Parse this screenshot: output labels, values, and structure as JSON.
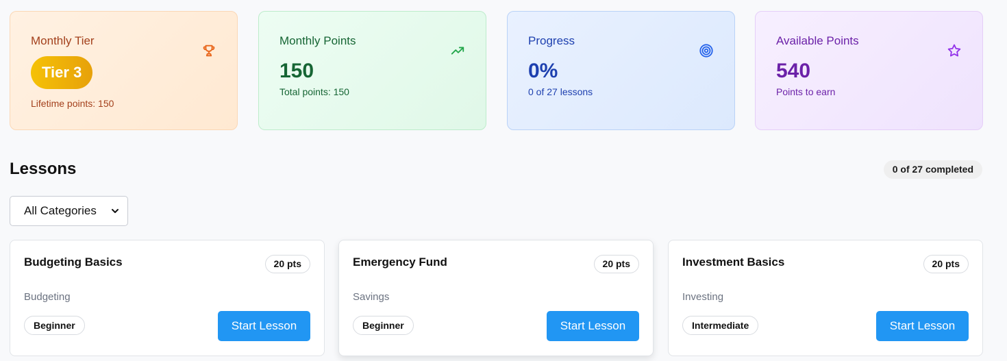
{
  "stats": {
    "tier": {
      "title": "Monthly Tier",
      "badge": "Tier 3",
      "sub": "Lifetime points: 150",
      "icon": "trophy-icon"
    },
    "points": {
      "title": "Monthly Points",
      "value": "150",
      "sub": "Total points: 150",
      "icon": "trending-up-icon"
    },
    "progress": {
      "title": "Progress",
      "value": "0%",
      "sub": "0 of 27 lessons",
      "icon": "target-icon"
    },
    "available": {
      "title": "Available Points",
      "value": "540",
      "sub": "Points to earn",
      "icon": "star-icon"
    }
  },
  "lessons": {
    "title": "Lessons",
    "completed": "0 of 27 completed",
    "filter": {
      "selected": "All Categories"
    },
    "items": [
      {
        "title": "Budgeting Basics",
        "points": "20 pts",
        "category": "Budgeting",
        "level": "Beginner",
        "button": "Start Lesson"
      },
      {
        "title": "Emergency Fund",
        "points": "20 pts",
        "category": "Savings",
        "level": "Beginner",
        "button": "Start Lesson"
      },
      {
        "title": "Investment Basics",
        "points": "20 pts",
        "category": "Investing",
        "level": "Intermediate",
        "button": "Start Lesson"
      }
    ]
  },
  "colors": {
    "tier_text": "#a3401c",
    "points_text": "#166534",
    "progress_text": "#1e40af",
    "available_text": "#6b21a8",
    "primary_button": "#2196f3",
    "tier_badge": "#f5c107"
  }
}
